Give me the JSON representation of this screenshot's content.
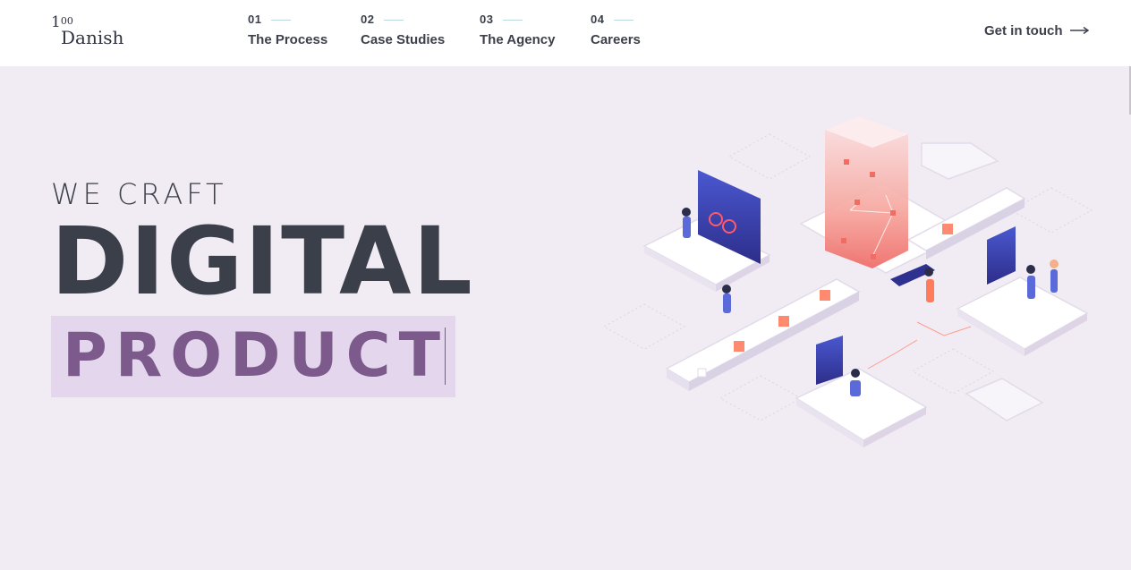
{
  "logo": {
    "number": "1",
    "superscript": "00",
    "word": "Danish"
  },
  "nav": [
    {
      "num": "01",
      "label": "The Process"
    },
    {
      "num": "02",
      "label": "Case Studies"
    },
    {
      "num": "03",
      "label": "The Agency"
    },
    {
      "num": "04",
      "label": "Careers"
    }
  ],
  "cta": {
    "label": "Get in touch",
    "icon": "arrow-right-icon"
  },
  "hero": {
    "line1": "WE CRAFT",
    "line2": "DIGITAL",
    "line3": "PRODUCT"
  },
  "colors": {
    "background": "#f1ebf3",
    "text": "#3b3f4a",
    "highlight_bg": "#e4d6ec",
    "highlight_text": "#7c5a8c",
    "accent_line": "#b9d9de"
  }
}
